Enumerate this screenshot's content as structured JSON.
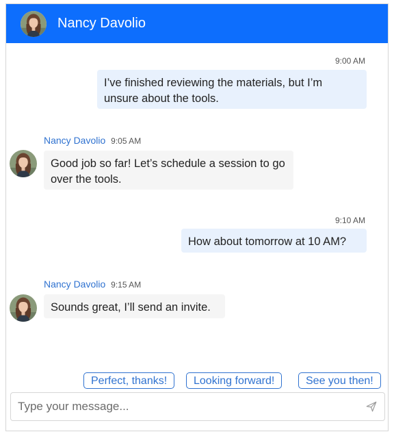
{
  "header": {
    "name": "Nancy Davolio"
  },
  "messages": [
    {
      "direction": "out",
      "time": "9:00 AM",
      "text": "I’ve finished reviewing the materials, but I’m unsure about the tools."
    },
    {
      "direction": "in",
      "sender": "Nancy Davolio",
      "time": "9:05 AM",
      "text": "Good job so far! Let’s schedule a session to go over the tools."
    },
    {
      "direction": "out",
      "time": "9:10 AM",
      "text": "How about tomorrow at 10 AM?"
    },
    {
      "direction": "in",
      "sender": "Nancy Davolio",
      "time": "9:15 AM",
      "text": "Sounds great, I’ll send an invite."
    }
  ],
  "suggestions": [
    "Perfect, thanks!",
    "Looking forward!",
    "See you then!"
  ],
  "input": {
    "placeholder": "Type your message...",
    "value": ""
  },
  "icons": {
    "send": "send-icon",
    "avatar": "user-avatar-photo"
  },
  "colors": {
    "header": "#0d6efd",
    "accent": "#2f72d0",
    "outgoing_bubble": "#e8f1fd",
    "incoming_bubble": "#f5f5f5"
  }
}
